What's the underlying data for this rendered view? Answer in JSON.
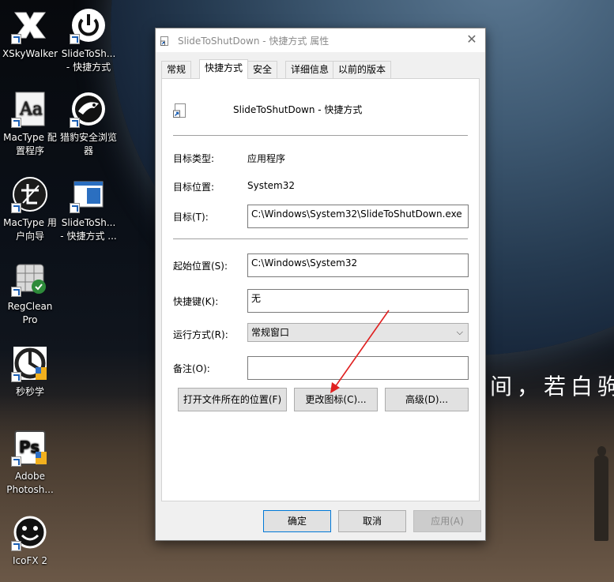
{
  "desktop": {
    "icons": [
      {
        "label": "XSkyWalker",
        "icon": "xskywalker-icon"
      },
      {
        "label": "SlideToSh... - 快捷方式",
        "icon": "power-icon"
      },
      {
        "label": "MacType 配置程序",
        "icon": "mactype-config-icon"
      },
      {
        "label": "猎豹安全浏览器",
        "icon": "cheetah-browser-icon"
      },
      {
        "label": "MacType 用户向导",
        "icon": "mactype-wizard-icon"
      },
      {
        "label": "SlideToSh... - 快捷方式 ...",
        "icon": "shortcut-window-icon"
      },
      {
        "label": "RegClean Pro",
        "icon": "regclean-icon"
      },
      {
        "label": "秒秒学",
        "icon": "miaomiaoxue-icon"
      },
      {
        "label": "Adobe Photosh...",
        "icon": "photoshop-icon"
      },
      {
        "label": "IcoFX 2",
        "icon": "smiley-icon"
      }
    ],
    "wallpaper_text": "间，若白驹"
  },
  "dialog": {
    "title": "SlideToShutDown - 快捷方式 属性",
    "tabs": [
      "常规",
      "快捷方式",
      "安全",
      "详细信息",
      "以前的版本"
    ],
    "active_tab": "快捷方式",
    "shortcut_name": "SlideToShutDown - 快捷方式",
    "target_type_label": "目标类型:",
    "target_type_value": "应用程序",
    "target_location_label": "目标位置:",
    "target_location_value": "System32",
    "target_label": "目标(T):",
    "target_value": "C:\\Windows\\System32\\SlideToShutDown.exe",
    "start_in_label": "起始位置(S):",
    "start_in_value": "C:\\Windows\\System32",
    "hotkey_label": "快捷键(K):",
    "hotkey_value": "无",
    "run_label": "运行方式(R):",
    "run_value": "常规窗口",
    "comment_label": "备注(O):",
    "comment_value": "",
    "open_location_button": "打开文件所在的位置(F)",
    "change_icon_button": "更改图标(C)...",
    "advanced_button": "高级(D)...",
    "ok_button": "确定",
    "cancel_button": "取消",
    "apply_button": "应用(A)"
  },
  "colors": {
    "accent": "#0078d7",
    "annotation_arrow": "#e02020"
  }
}
